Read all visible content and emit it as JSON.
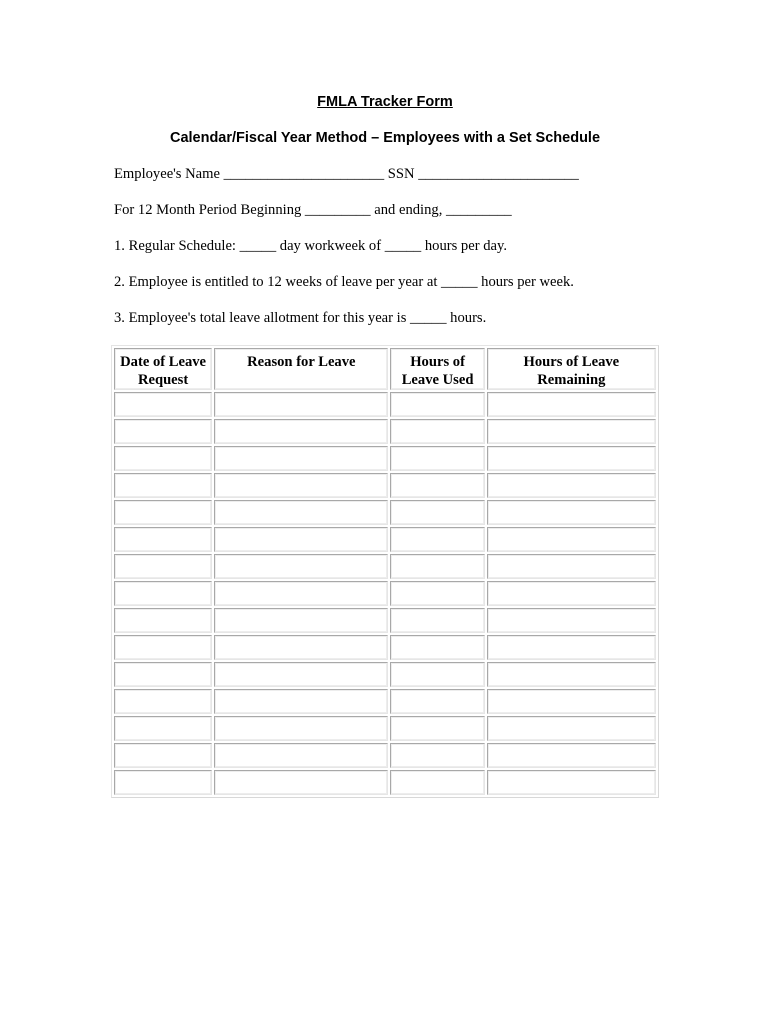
{
  "document": {
    "title": "FMLA Tracker Form",
    "subtitle": "Calendar/Fiscal Year Method – Employees with a Set Schedule",
    "lines": [
      "Employee's Name ______________________ SSN ______________________",
      "For 12 Month Period Beginning _________ and ending, _________",
      "1. Regular Schedule: _____ day workweek of _____ hours per day.",
      "2. Employee is entitled to 12 weeks of leave per year at _____ hours per week.",
      "3. Employee's total leave allotment for this year is _____ hours."
    ]
  },
  "table": {
    "headers": [
      "Date of Leave Request",
      "Reason for Leave",
      "Hours of Leave Used",
      "Hours of Leave Remaining"
    ],
    "header_lines": [
      [
        "Date of Leave",
        "Request"
      ],
      [
        "Reason for Leave"
      ],
      [
        "Hours of",
        "Leave Used"
      ],
      [
        "Hours of Leave",
        "Remaining"
      ]
    ],
    "row_count": 15,
    "rows": [
      [
        "",
        "",
        "",
        ""
      ],
      [
        "",
        "",
        "",
        ""
      ],
      [
        "",
        "",
        "",
        ""
      ],
      [
        "",
        "",
        "",
        ""
      ],
      [
        "",
        "",
        "",
        ""
      ],
      [
        "",
        "",
        "",
        ""
      ],
      [
        "",
        "",
        "",
        ""
      ],
      [
        "",
        "",
        "",
        ""
      ],
      [
        "",
        "",
        "",
        ""
      ],
      [
        "",
        "",
        "",
        ""
      ],
      [
        "",
        "",
        "",
        ""
      ],
      [
        "",
        "",
        "",
        ""
      ],
      [
        "",
        "",
        "",
        ""
      ],
      [
        "",
        "",
        "",
        ""
      ],
      [
        "",
        "",
        "",
        ""
      ]
    ]
  }
}
